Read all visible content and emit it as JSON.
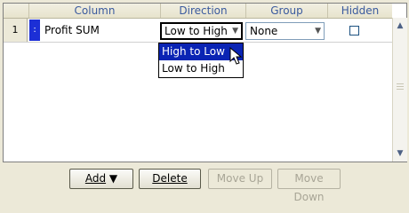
{
  "grid": {
    "headers": {
      "column": "Column",
      "direction": "Direction",
      "group": "Group",
      "hidden": "Hidden"
    },
    "rows": [
      {
        "index": "1",
        "handle": ":",
        "column": "Profit SUM",
        "direction": "Low to High",
        "group": "None",
        "hidden": false
      }
    ]
  },
  "direction_dropdown": {
    "options": [
      "High to Low",
      "Low to High"
    ],
    "highlighted": "High to Low"
  },
  "buttons": {
    "add": "Add",
    "delete": "Delete",
    "move_up": "Move Up",
    "move_down": "Move Down"
  },
  "icons": {
    "add_dropdown": "caret-down-icon",
    "combo_arrow": "chevron-down-icon",
    "scroll_up": "arrow-up-icon",
    "scroll_down": "arrow-down-icon"
  }
}
